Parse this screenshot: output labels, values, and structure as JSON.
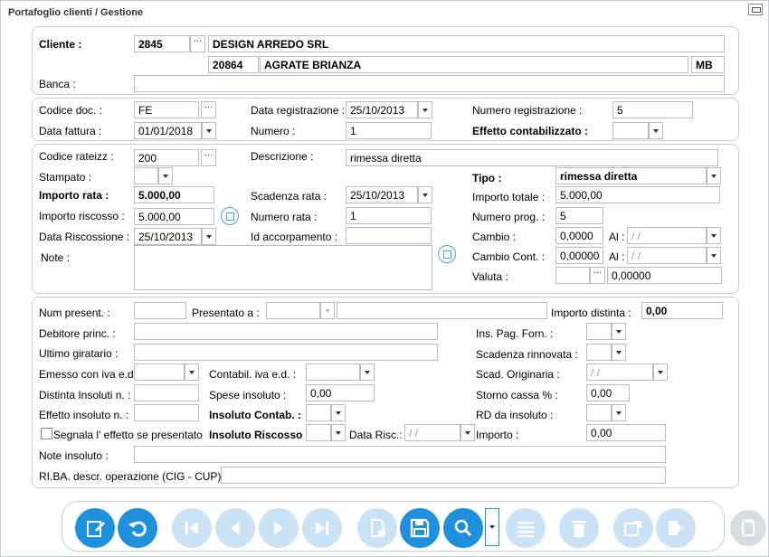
{
  "window": {
    "title": "Portafoglio clienti / Gestione"
  },
  "cliente": {
    "label": "Cliente :",
    "code": "2845",
    "name": "DESIGN ARREDO SRL",
    "cap": "20864",
    "city": "AGRATE BRIANZA",
    "province": "MB",
    "banca_label": "Banca :",
    "banca_value": ""
  },
  "documento": {
    "codice_doc_label": "Codice doc. :",
    "codice_doc_value": "FE",
    "data_registrazione_label": "Data registrazione :",
    "data_registrazione_value": "25/10/2013",
    "numero_registrazione_label": "Numero registrazione :",
    "numero_registrazione_value": "5",
    "data_fattura_label": "Data fattura :",
    "data_fattura_value": "01/01/2018",
    "numero_label": "Numero :",
    "numero_value": "1",
    "effetto_contabilizzato_label": "Effetto contabilizzato :",
    "effetto_contabilizzato_value": ""
  },
  "rata": {
    "codice_rateizz_label": "Codice rateizz :",
    "codice_rateizz_value": "200",
    "descrizione_label": "Descrizione :",
    "descrizione_value": "rimessa diretta",
    "stampato_label": "Stampato :",
    "stampato_value": "",
    "tipo_label": "Tipo :",
    "tipo_value": "rimessa diretta",
    "importo_rata_label": "Importo rata :",
    "importo_rata_value": "5.000,00",
    "scadenza_rata_label": "Scadenza rata :",
    "scadenza_rata_value": "25/10/2013",
    "importo_totale_label": "Importo totale :",
    "importo_totale_value": "5.000,00",
    "importo_riscosso_label": "Importo riscosso :",
    "importo_riscosso_value": "5.000,00",
    "numero_rata_label": "Numero rata :",
    "numero_rata_value": "1",
    "numero_prog_label": "Numero prog. :",
    "numero_prog_value": "5",
    "data_riscossione_label": "Data Riscossione :",
    "data_riscossione_value": "25/10/2013",
    "id_accorpamento_label": "Id accorpamento :",
    "id_accorpamento_value": "",
    "cambio_label": "Cambio :",
    "cambio_value": "0,0000",
    "cambio_al_label": "Al :",
    "cambio_al_value": "/ /",
    "cambio_cont_label": "Cambio Cont. :",
    "cambio_cont_value": "0,00000",
    "cambio_cont_al_label": "Al :",
    "cambio_cont_al_value": "/ /",
    "note_label": "Note :",
    "note_value": "",
    "valuta_label": "Valuta :",
    "valuta_code": "",
    "valuta_value": "0,00000"
  },
  "presentazione": {
    "num_present_label": "Num present. :",
    "num_present_value": "",
    "presentato_a_label": "Presentato a :",
    "presentato_a_value": "",
    "importo_distinta_label": "Importo distinta  :",
    "importo_distinta_value": "0,00",
    "debitore_label": "Debitore princ. :",
    "debitore_value": "",
    "ins_pag_label": "Ins. Pag. Forn. :",
    "ultimo_giratario_label": "Ultimo giratario :",
    "ultimo_giratario_value": "",
    "scadenza_rinnovata_label": "Scadenza rinnovata :",
    "emesso_iva_label": "Emesso con iva e.d. :",
    "contabil_iva_label": "Contabil. iva e.d. :",
    "scad_originaria_label": "Scad. Originaria :",
    "scad_originaria_value": "/ /",
    "distinta_insoluti_label": "Distinta Insoluti n. :",
    "distinta_insoluti_value": "",
    "spese_insoluto_label": "Spese insoluto :",
    "spese_insoluto_value": "0,00",
    "storno_cassa_label": "Storno cassa % :",
    "storno_cassa_value": "0,00",
    "effetto_insoluto_label": "Effetto insoluto n. :",
    "effetto_insoluto_value": "",
    "insoluto_contab_label": "Insoluto Contab. :",
    "rd_insoluto_label": "RD da insoluto :",
    "segnala_label": "Segnala l' effetto se presentato",
    "insoluto_riscosso_label": "Insoluto Riscosso :",
    "data_risc_label": "Data Risc.:",
    "data_risc_value": "/ /",
    "importo_label": "Importo :",
    "importo_value": "0,00",
    "note_insoluto_label": "Note insoluto :",
    "note_insoluto_value": "",
    "riba_label": "RI.BA. descr. operazione (CIG - CUP) :",
    "riba_value": ""
  },
  "colors": {
    "accent": "#1e90dc",
    "accent_disabled": "#c9e2f5",
    "border": "#c8cdd4"
  },
  "toolbar": {
    "buttons": [
      "edit-icon",
      "undo-icon",
      "first-icon",
      "prev-icon",
      "next-icon",
      "last-icon",
      "copy-icon",
      "save-icon",
      "search-icon",
      "list-icon",
      "delete-icon",
      "export-icon",
      "exit-icon"
    ]
  }
}
